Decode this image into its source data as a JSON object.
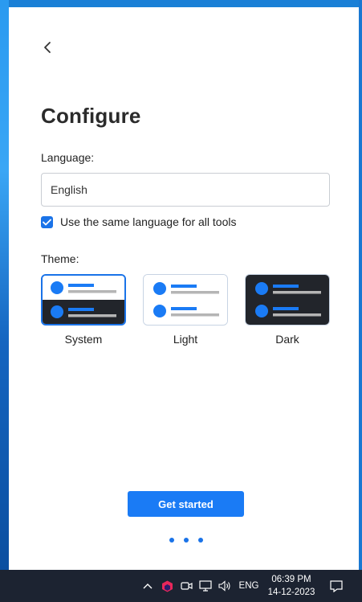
{
  "window": {
    "title": "Configure",
    "language_label": "Language:",
    "language_value": "English",
    "same_language_label": "Use the same language for all tools",
    "same_language_checked": true,
    "theme_label": "Theme:",
    "themes": [
      {
        "label": "System",
        "selected": true
      },
      {
        "label": "Light",
        "selected": false
      },
      {
        "label": "Dark",
        "selected": false
      }
    ],
    "primary_button": "Get started",
    "pagination_dots": 3
  },
  "taskbar": {
    "language": "ENG",
    "time": "06:39 PM",
    "date": "14-12-2023"
  },
  "colors": {
    "accent": "#1a73e8",
    "button": "#1a7bf5",
    "dark_theme_bg": "#22252b",
    "taskbar_bg": "#1c2331"
  },
  "icons": [
    "back-arrow-icon",
    "check-icon",
    "chevron-up-icon",
    "app-tray-icon",
    "camera-icon",
    "network-icon",
    "volume-icon",
    "notification-icon"
  ]
}
